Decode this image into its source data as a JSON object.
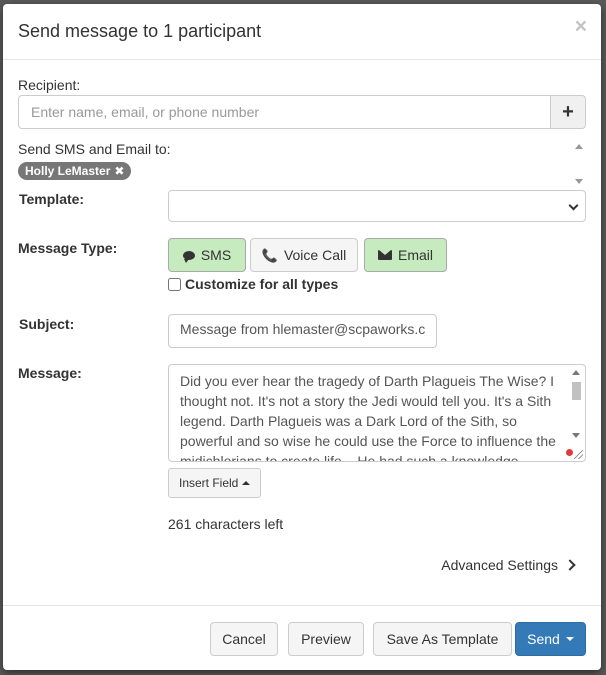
{
  "modal": {
    "title": "Send message to 1 participant",
    "close_glyph": "×"
  },
  "recipient": {
    "label": "Recipient:",
    "placeholder": "Enter name, email, or phone number",
    "add_glyph": "+"
  },
  "send_to": {
    "label": "Send SMS and Email to:",
    "participants": [
      {
        "name": "Holly LeMaster",
        "remove_glyph": "✖"
      }
    ]
  },
  "template": {
    "label": "Template:",
    "selected": ""
  },
  "message_type": {
    "label": "Message Type:",
    "options": [
      {
        "label": "SMS",
        "icon": "speech-bubble-icon",
        "active": true
      },
      {
        "label": "Voice Call",
        "icon": "phone-icon",
        "active": false
      },
      {
        "label": "Email",
        "icon": "envelope-icon",
        "active": true
      }
    ],
    "customize_label": "Customize for all types",
    "customize_checked": false
  },
  "subject": {
    "label": "Subject:",
    "value": "Message from hlemaster@scpaworks.c"
  },
  "message": {
    "label": "Message:",
    "value": "Did you ever hear the tragedy of Darth Plagueis The Wise? I thought not. It's not a story the Jedi would tell you. It's a Sith legend. Darth Plagueis was a Dark Lord of the Sith, so powerful and so wise he could use the Force to influence the midichlorians to create life... He had such a knowledge"
  },
  "insert_field": {
    "label": "Insert Field"
  },
  "chars_left": "261 characters left",
  "advanced_settings": "Advanced Settings",
  "footer": {
    "cancel": "Cancel",
    "preview": "Preview",
    "save_template": "Save As Template",
    "send": "Send"
  },
  "colors": {
    "active_type": "#c6ebbf",
    "primary": "#337ab7",
    "tag": "#777777"
  }
}
